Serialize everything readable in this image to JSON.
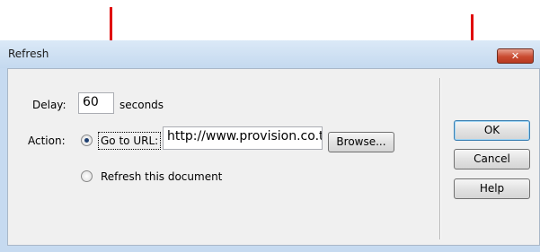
{
  "window": {
    "title": "Refresh",
    "close_glyph": "✕"
  },
  "delay": {
    "label": "Delay:",
    "value": "60",
    "unit": "seconds"
  },
  "action": {
    "label": "Action:",
    "goto_label": "Go to URL:",
    "url_value": "http://www.provision.co.th",
    "browse_label": "Browse...",
    "refresh_label": "Refresh this document",
    "selected": "goto-url"
  },
  "buttons": {
    "ok": "OK",
    "cancel": "Cancel",
    "help": "Help"
  },
  "annotations": {
    "arrow_color": "#e00000"
  }
}
